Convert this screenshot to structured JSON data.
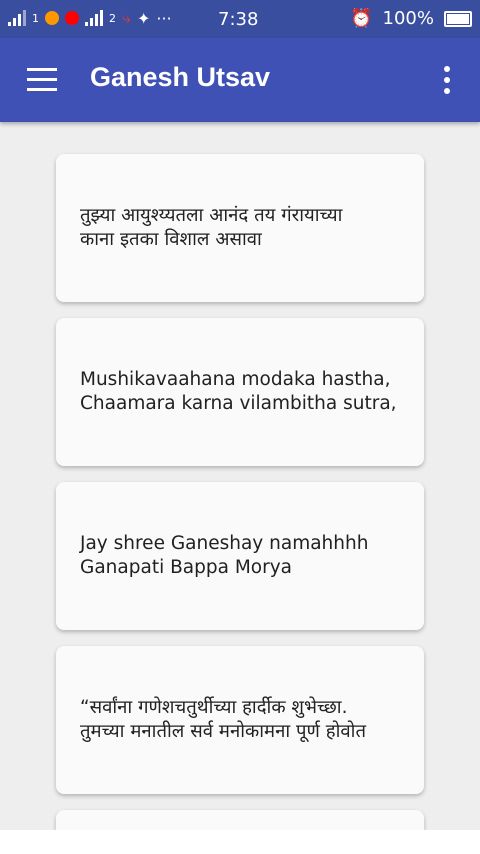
{
  "status_bar": {
    "time": "7:38",
    "battery": "100%",
    "sim1_label": "1",
    "sim2_label": "2",
    "overflow": "···"
  },
  "toolbar": {
    "title": "Ganesh Utsav"
  },
  "cards": [
    "तुझ्या आयुश्य्यतला आनंद तय गंरायाच्या\nकाना इतका विशाल असावा",
    "Mushikavaahana modaka hastha,\nChaamara karna vilambitha sutra,",
    "Jay shree Ganeshay namahhhh\nGanapati Bappa Morya",
    "“सर्वांना गणेशचतुर्थीच्या हार्दीक शुभेच्छा.\nतुमच्या मनातील सर्व मनोकामना पूर्ण होवोत"
  ],
  "colors": {
    "toolbar": "#3f51b5",
    "status_bar": "#3a4ea0",
    "background": "#eeeeee",
    "card": "#fafafa"
  },
  "icons": [
    "signal-icon",
    "notification-icons",
    "alarm-icon",
    "battery-icon",
    "menu-icon",
    "more-vert-icon"
  ]
}
